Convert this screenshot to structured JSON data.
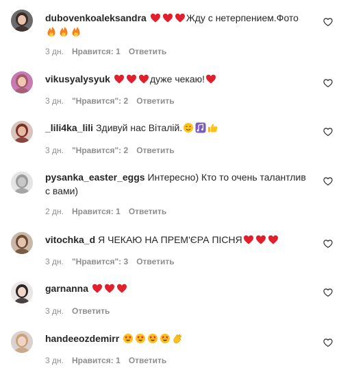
{
  "comments": [
    {
      "username": "dubovenkoaleksandra",
      "text": "Жду с нетерпением.Фото",
      "emojis_before": [
        "heart-red",
        "heart-red",
        "heart-red"
      ],
      "emojis_after": [
        "fire",
        "fire",
        "fire"
      ],
      "age": "3 дн.",
      "likes": "Нравится: 1",
      "reply": "Ответить"
    },
    {
      "username": "vikusyalysyuk",
      "text": "дуже чекаю!",
      "emojis_before": [
        "heart-red",
        "heart-red",
        "heart-red"
      ],
      "emojis_after": [
        "heart-red"
      ],
      "age": "3 дн.",
      "likes": "\"Нравится\": 2",
      "reply": "Ответить"
    },
    {
      "username": "_lili4ka_lili",
      "text": "Здивуй нас Віталій.",
      "emojis_before": [],
      "emojis_after": [
        "wink",
        "notes",
        "thumbs-up"
      ],
      "age": "3 дн.",
      "likes": "\"Нравится\": 2",
      "reply": "Ответить"
    },
    {
      "username": "pysanka_easter_eggs",
      "text": "Интересно) Кто то очень талантлив с вами)",
      "emojis_before": [],
      "emojis_after": [],
      "age": "2 дн.",
      "likes": "Нравится: 1",
      "reply": "Ответить"
    },
    {
      "username": "vitochka_d",
      "text": "Я ЧЕКАЮ НА ПРЕМ'ЄРА ПІСНЯ",
      "emojis_before": [],
      "emojis_after": [
        "heart-red",
        "heart-red",
        "heart-red"
      ],
      "age": "3 дн.",
      "likes": "\"Нравится\": 3",
      "reply": "Ответить"
    },
    {
      "username": "garnanna",
      "text": "",
      "emojis_before": [
        "heart-red",
        "heart-red",
        "heart-red"
      ],
      "emojis_after": [],
      "age": "3 дн.",
      "likes": "",
      "reply": "Ответить"
    },
    {
      "username": "handeeozdemirr",
      "text": "",
      "emojis_before": [
        "star-struck",
        "star-struck",
        "star-struck",
        "star-struck",
        "clap"
      ],
      "emojis_after": [],
      "age": "3 дн.",
      "likes": "Нравится: 1",
      "reply": "Ответить"
    }
  ],
  "colors": {
    "text": "#262626",
    "secondary": "#8e8e8e",
    "heart": "#ed4956"
  },
  "icons": {
    "like": "heart-outline-icon"
  }
}
